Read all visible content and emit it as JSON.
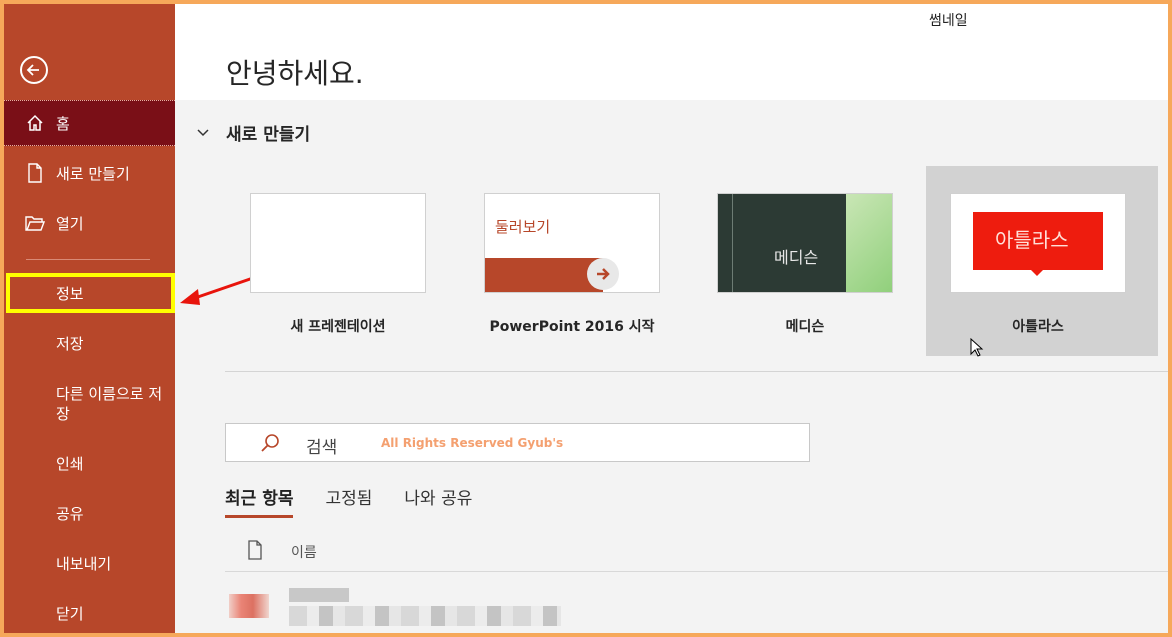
{
  "window": {
    "thumbnail_label": "썸네일"
  },
  "sidebar": {
    "items": [
      {
        "label": "홈",
        "icon": "home-icon"
      },
      {
        "label": "새로 만들기",
        "icon": "new-file-icon"
      },
      {
        "label": "열기",
        "icon": "open-folder-icon"
      },
      {
        "label": "정보"
      },
      {
        "label": "저장"
      },
      {
        "label": "다른 이름으로 저장"
      },
      {
        "label": "인쇄"
      },
      {
        "label": "공유"
      },
      {
        "label": "내보내기"
      },
      {
        "label": "닫기"
      }
    ],
    "accent": "#b7472a",
    "active_bg": "#7a0f17",
    "highlight_color": "#ffff00"
  },
  "main": {
    "greeting": "안녕하세요.",
    "new_section": {
      "title": "새로 만들기",
      "templates": [
        {
          "label": "새 프레젠테이션"
        },
        {
          "label": "PowerPoint 2016 시작",
          "thumb_text": "둘러보기"
        },
        {
          "label": "메디슨",
          "thumb_text": "메디슨"
        },
        {
          "label": "아틀라스",
          "thumb_text": "아틀라스"
        }
      ]
    },
    "search": {
      "placeholder": "검색",
      "watermark": "All Rights Reserved Gyub's"
    },
    "tabs": [
      {
        "label": "최근 항목",
        "active": true
      },
      {
        "label": "고정됨",
        "active": false
      },
      {
        "label": "나와 공유",
        "active": false
      }
    ],
    "list": {
      "column_name": "이름"
    }
  }
}
